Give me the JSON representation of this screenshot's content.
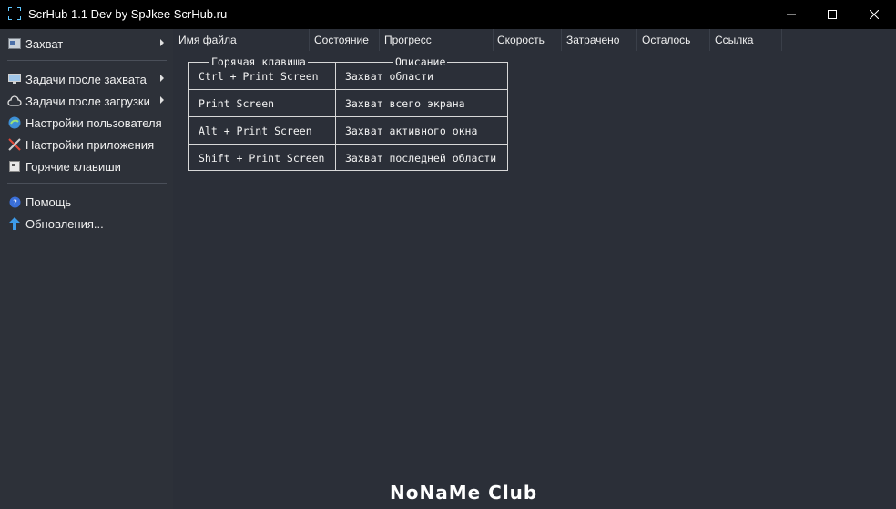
{
  "window": {
    "title": "ScrHub 1.1 Dev by SpJkee ScrHub.ru",
    "minimize_glyph": "—",
    "maximize_glyph": "☐",
    "close_glyph": "✕"
  },
  "sidebar": {
    "items": [
      {
        "label": "Захват",
        "icon": "screenshot-icon",
        "submenu": true
      },
      {
        "label": "Задачи после захвата",
        "icon": "monitor-icon",
        "submenu": true
      },
      {
        "label": "Задачи после загрузки",
        "icon": "cloud-upload-icon",
        "submenu": true
      },
      {
        "label": "Настройки пользователя",
        "icon": "user-settings-icon",
        "submenu": false
      },
      {
        "label": "Настройки приложения",
        "icon": "tools-icon",
        "submenu": false
      },
      {
        "label": "Горячие клавиши",
        "icon": "keyboard-icon",
        "submenu": false
      },
      {
        "label": "Помощь",
        "icon": "help-icon",
        "submenu": false
      },
      {
        "label": "Обновления...",
        "icon": "update-arrow-icon",
        "submenu": false
      }
    ]
  },
  "columns": [
    "Имя файла",
    "Состояние",
    "Прогресс",
    "Скорость",
    "Затрачено",
    "Осталось",
    "Ссылка"
  ],
  "hotkeys": {
    "header_key": "Горячая клавиша",
    "header_desc": "Описание",
    "rows": [
      {
        "key": "Ctrl + Print Screen",
        "desc": "Захват области"
      },
      {
        "key": "Print Screen",
        "desc": "Захват всего экрана"
      },
      {
        "key": "Alt + Print Screen",
        "desc": "Захват активного окна"
      },
      {
        "key": "Shift + Print Screen",
        "desc": "Захват последней области"
      }
    ]
  },
  "watermark": "NoNaMe Club",
  "colors": {
    "background": "#2b2f38",
    "titlebar": "#000000",
    "text": "#e6e6e6",
    "accent": "#1e90ff"
  }
}
